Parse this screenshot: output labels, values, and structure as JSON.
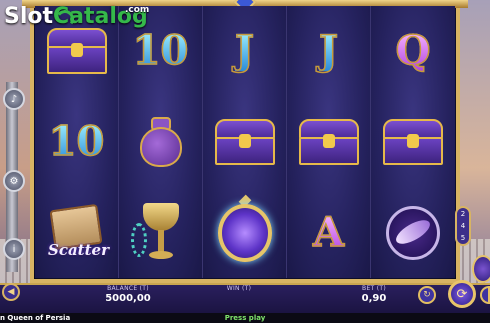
{
  "watermark": {
    "brand_part1": "Slot",
    "brand_part2": "Catalog",
    "tld": ".com"
  },
  "game": {
    "title": "n Queen of Persia",
    "status": "Press play"
  },
  "reels": [
    [
      "chest",
      "10",
      "scroll"
    ],
    [
      "10",
      "pouch",
      "goblet"
    ],
    [
      "J",
      "chest",
      "wild-gem"
    ],
    [
      "J",
      "chest",
      "A"
    ],
    [
      "Q",
      "chest",
      "emblem"
    ]
  ],
  "symbols": {
    "scatter_label": "Scatter"
  },
  "paylines_indicator": [
    "2",
    "4",
    "5"
  ],
  "bottom_bar": {
    "balance_label": "BALANCE (T)",
    "balance_value": "5000,00",
    "win_label": "WIN (T)",
    "win_value": "",
    "bet_label": "BET (T)",
    "bet_value": "0,90"
  },
  "colors": {
    "frame_gold": "#d8b463",
    "reel_bg": "#25225e",
    "status_green": "#7ee36a",
    "brand_green": "#35b84a"
  },
  "icons": {
    "menu": "arrow-left-icon",
    "autoplay": "autoplay-icon",
    "spin": "spin-icon",
    "left_controls": [
      "sound-icon",
      "settings-icon",
      "info-icon"
    ]
  }
}
